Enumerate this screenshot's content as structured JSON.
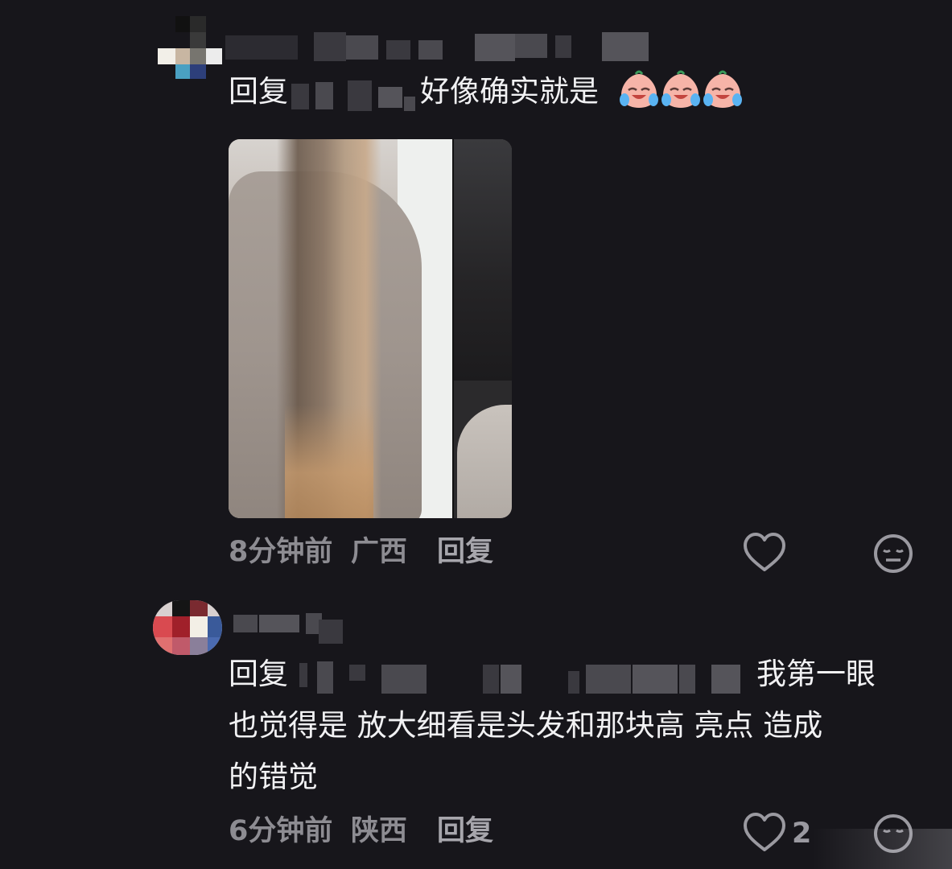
{
  "comments": [
    {
      "reply_prefix": "回复",
      "text": "好像确实就是",
      "emoji_count": 3,
      "emoji_name": "crying-laughing-face",
      "time": "8分钟前",
      "location": "广西",
      "reply_label": "回复",
      "like_count": ""
    },
    {
      "reply_prefix": "回复",
      "text_line1": "我第一眼",
      "text_line2": "也觉得是  放大细看是头发和那块高  亮点  造成",
      "text_line3": "的错觉",
      "time": "6分钟前",
      "location": "陕西",
      "reply_label": "回复",
      "like_count": "2"
    }
  ],
  "icons": {
    "like": "heart-outline-icon",
    "dislike": "meh-face-icon"
  },
  "colors": {
    "background": "#17161b",
    "text": "#f1f1f3",
    "meta": "#8d8c92"
  }
}
